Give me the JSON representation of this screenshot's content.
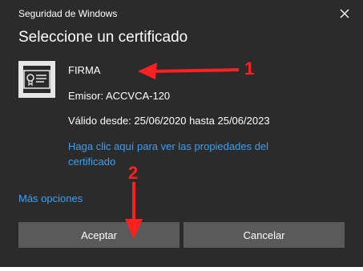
{
  "window": {
    "title": "Seguridad de Windows",
    "heading": "Seleccione un certificado"
  },
  "certificate": {
    "name": "FIRMA",
    "issuer": "Emisor: ACCVCA-120",
    "validity": "Válido desde: 25/06/2020 hasta 25/06/2023",
    "properties_link": "Haga clic aquí para ver las propiedades del certificado"
  },
  "more_options": "Más opciones",
  "buttons": {
    "accept": "Aceptar",
    "cancel": "Cancelar"
  },
  "annotations": {
    "step1": "1",
    "step2": "2",
    "color": "#ff2020"
  },
  "colors": {
    "background": "#2b2b2b",
    "link": "#3aa0f3",
    "button": "#5a5a5a"
  },
  "icons": [
    "close-icon",
    "certificate-icon",
    "arrow-left-icon",
    "arrow-down-icon"
  ]
}
